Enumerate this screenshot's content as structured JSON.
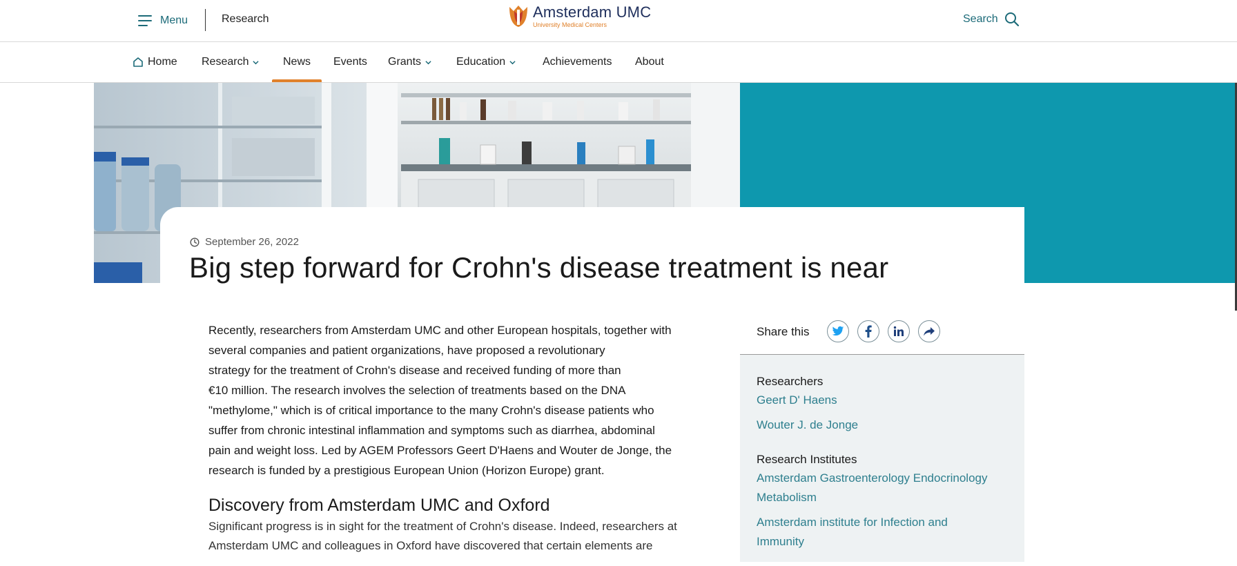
{
  "header": {
    "menu_label": "Menu",
    "section_label": "Research",
    "logo_name": "Amsterdam UMC",
    "logo_subtitle": "University Medical Centers",
    "search_label": "Search"
  },
  "nav": {
    "items": [
      {
        "label": "Home",
        "icon": "home-icon"
      },
      {
        "label": "Research",
        "dropdown": true
      },
      {
        "label": "News",
        "active": true
      },
      {
        "label": "Events"
      },
      {
        "label": "Grants",
        "dropdown": true
      },
      {
        "label": "Education",
        "dropdown": true
      },
      {
        "label": "Achievements"
      },
      {
        "label": "About"
      }
    ]
  },
  "article": {
    "date": "September 26, 2022",
    "title": "Big step forward for Crohn's disease treatment is near",
    "intro_lines": [
      "Recently, researchers from Amsterdam UMC and other European hospitals, together with",
      "several companies and patient organizations, have proposed a revolutionary",
      "strategy for the treatment of Crohn's disease and received funding of more than",
      "€10 million. The research involves the selection of treatments based on the DNA",
      "\"methylome,\" which is of critical importance to the many Crohn's disease patients who",
      "suffer from chronic intestinal inflammation and symptoms such as diarrhea, abdominal",
      "pain and weight loss. Led by AGEM Professors Geert D'Haens and Wouter de Jonge, the",
      "research is funded by a prestigious European Union (Horizon Europe) grant."
    ],
    "subheading": "Discovery from Amsterdam UMC and Oxford",
    "body_lines": [
      "Significant progress is in sight for the treatment of Crohn's disease. Indeed, researchers at",
      "Amsterdam UMC and colleagues in Oxford have discovered that certain elements are"
    ]
  },
  "sidebar": {
    "share_label": "Share this",
    "share_buttons": [
      "twitter-icon",
      "facebook-icon",
      "linkedin-icon",
      "share-icon"
    ],
    "researchers_heading": "Researchers",
    "researchers": [
      "Geert D' Haens",
      "Wouter J. de Jonge"
    ],
    "institutes_heading": "Research Institutes",
    "institutes": [
      [
        "Amsterdam Gastroenterology Endocrinology",
        "Metabolism"
      ],
      [
        "Amsterdam institute for Infection and",
        "Immunity"
      ]
    ]
  },
  "colors": {
    "teal": "#0e98ae",
    "link": "#2e7f8e",
    "accent_orange": "#e0812b",
    "logo_navy": "#1f2f5c",
    "sidebar_bg": "#eef2f3"
  }
}
